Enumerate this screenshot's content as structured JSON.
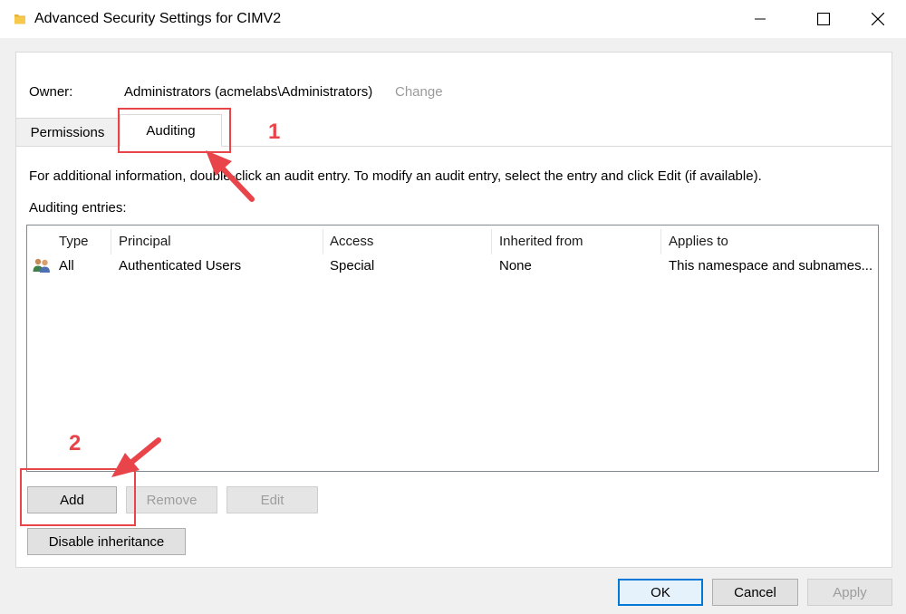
{
  "window": {
    "title": "Advanced Security Settings for CIMV2"
  },
  "owner": {
    "label": "Owner:",
    "value": "Administrators (acmelabs\\Administrators)",
    "change_link": "Change"
  },
  "tabs": [
    {
      "label": "Permissions",
      "selected": false
    },
    {
      "label": "Auditing",
      "selected": true
    }
  ],
  "info_text": "For additional information, double-click an audit entry. To modify an audit entry, select the entry and click Edit (if available).",
  "entries_label": "Auditing entries:",
  "table": {
    "columns": [
      "Type",
      "Principal",
      "Access",
      "Inherited from",
      "Applies to"
    ],
    "rows": [
      {
        "icon": "users-icon",
        "type": "All",
        "principal": "Authenticated Users",
        "access": "Special",
        "inherited_from": "None",
        "applies_to": "This namespace and subnames..."
      }
    ]
  },
  "buttons": {
    "add": "Add",
    "remove": "Remove",
    "edit": "Edit",
    "disable_inheritance": "Disable inheritance",
    "ok": "OK",
    "cancel": "Cancel",
    "apply": "Apply"
  },
  "annotations": {
    "step1": "1",
    "step2": "2",
    "color": "#e8444a"
  },
  "colors": {
    "accent": "#0078d7",
    "disabled_text": "#9d9d9d",
    "link_disabled": "#9a9a9a"
  }
}
